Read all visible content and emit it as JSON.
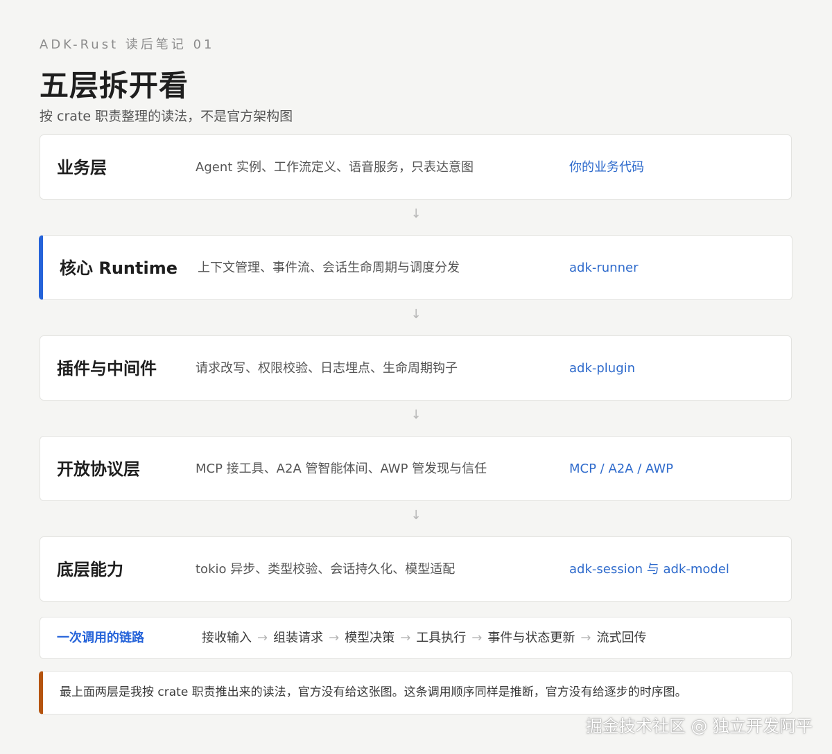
{
  "header": {
    "eyebrow": "ADK-Rust 读后笔记 01",
    "title": "五层拆开看",
    "subtitle": "按 crate 职责整理的读法，不是官方架构图"
  },
  "layers": [
    {
      "name": "业务层",
      "desc": "Agent 实例、工作流定义、语音服务，只表达意图",
      "crate": "你的业务代码"
    },
    {
      "name": "核心 Runtime",
      "desc": "上下文管理、事件流、会话生命周期与调度分发",
      "crate": "adk-runner"
    },
    {
      "name": "插件与中间件",
      "desc": "请求改写、权限校验、日志埋点、生命周期钩子",
      "crate": "adk-plugin"
    },
    {
      "name": "开放协议层",
      "desc": "MCP 接工具、A2A 管智能体间、AWP 管发现与信任",
      "crate": "MCP / A2A / AWP"
    },
    {
      "name": "底层能力",
      "desc": "tokio 异步、类型校验、会话持久化、模型适配",
      "crate": "adk-session 与 adk-model"
    }
  ],
  "arrow_glyph": "↓",
  "flow": {
    "label": "一次调用的链路",
    "steps": [
      "接收输入",
      "组装请求",
      "模型决策",
      "工具执行",
      "事件与状态更新",
      "流式回传"
    ],
    "separator": "→"
  },
  "note": {
    "text": "最上面两层是我按 crate 职责推出来的读法，官方没有给这张图。这条调用顺序同样是推断，官方没有给逐步的时序图。"
  },
  "watermark": "掘金技术社区 @ 独立开发阿平",
  "colors": {
    "accent_blue": "#2563d9",
    "crate_blue": "#2f6bcc",
    "note_orange": "#b5540f",
    "background": "#f5f5f3"
  }
}
